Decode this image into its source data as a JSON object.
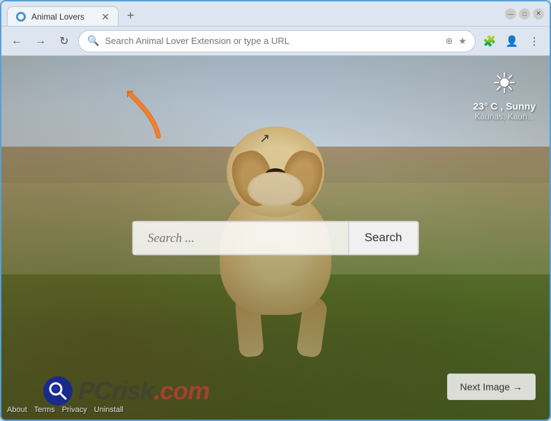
{
  "browser": {
    "tab_title": "Animal Lovers",
    "address_placeholder": "Search Animal Lover Extension or type a URL",
    "address_value": "Search Animal Lover Extension or type a URL"
  },
  "page": {
    "search_placeholder": "Search ...",
    "search_button_label": "Search",
    "next_image_label": "Next Image →",
    "weather": {
      "temperature": "23° C , Sunny",
      "location": "Kaunas, Kaun...",
      "sun_symbol": "☀"
    },
    "footer_links": [
      {
        "label": "About"
      },
      {
        "label": "Terms"
      },
      {
        "label": "Privacy"
      },
      {
        "label": "Uninstall"
      }
    ],
    "watermark": {
      "logo_symbol": "🔍",
      "text_pc": "PC",
      "text_risk": "risk",
      "text_com": ".com"
    }
  },
  "window_controls": {
    "minimize_label": "—",
    "maximize_label": "□",
    "close_label": "✕"
  }
}
